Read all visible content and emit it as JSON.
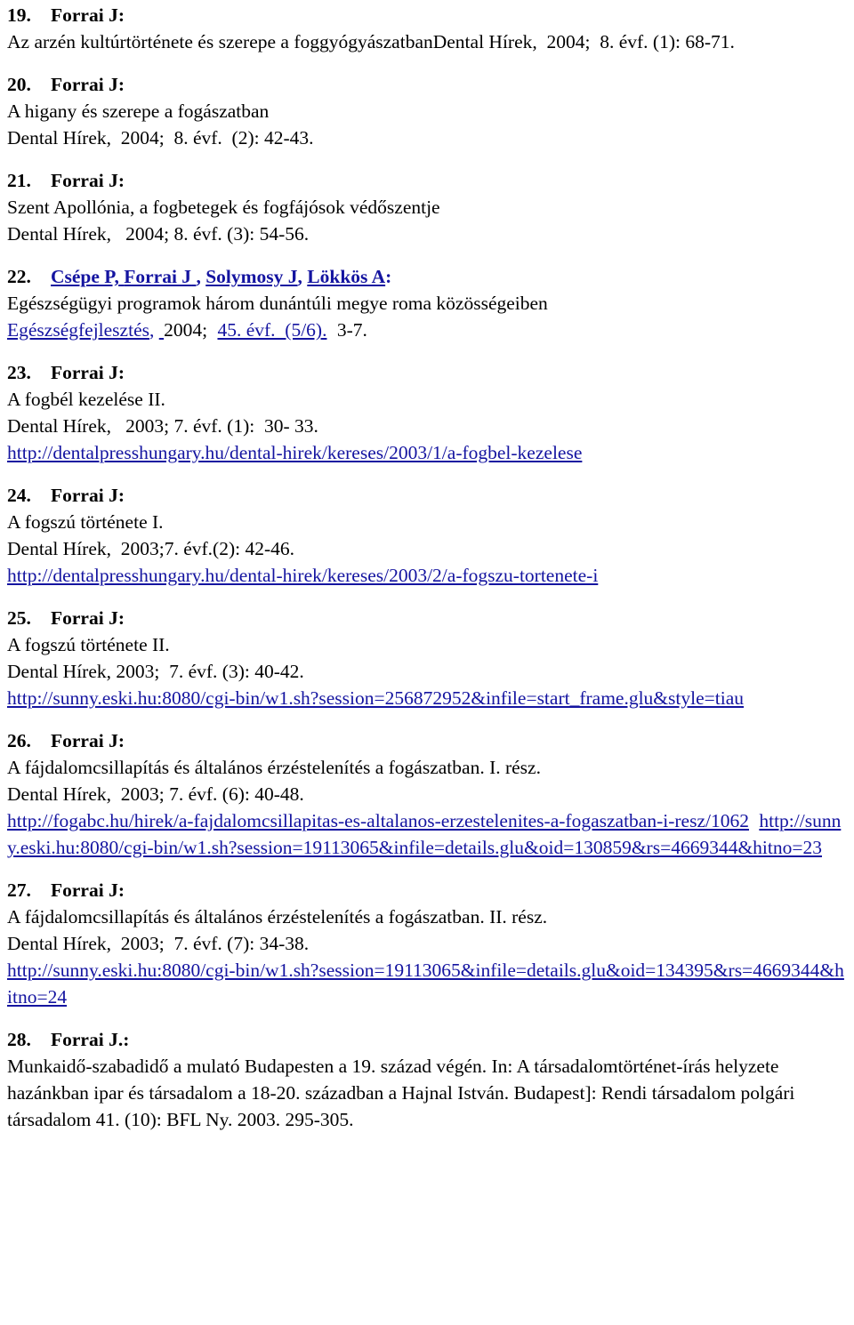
{
  "document": {
    "type": "bibliography-list",
    "language": "hu",
    "link_color": "#1414a0",
    "text_color": "#000000",
    "background": "#ffffff"
  },
  "entries": [
    {
      "number": "19.",
      "author": "Forrai J:",
      "lines": [
        "Az arzén kultúrtörténete és szerepe a foggyógyászatbanDental Hírek,  2004;  8. évf. (1): 68-71."
      ]
    },
    {
      "number": "20.",
      "author": "Forrai J:",
      "lines": [
        "A higany és szerepe a fogászatban",
        "Dental Hírek,  2004;  8. évf.  (2): 42-43."
      ]
    },
    {
      "number": "21.",
      "author": "Forrai J:",
      "lines": [
        "Szent Apollónia, a fogbetegek és fogfájósok védőszentje",
        "Dental Hírek,   2004; 8. évf. (3): 54-56."
      ]
    },
    {
      "number": "22.",
      "authors_linked": {
        "part1": "Csépe P,",
        "part2_bold": "Forrai J",
        "comma1": ",",
        "part3": "Solymosy J",
        "comma2": ",",
        "part4": "Lökkös A",
        "colon": ":"
      },
      "title": "Egészségügyi programok három dunántúli megye roma közösségeiben",
      "source_link1": "Egészségfejlesztés",
      "source_comma": ",",
      "source_year": "2004;",
      "source_link2": "45. évf.  (5/6).",
      "source_pages": "3-7."
    },
    {
      "number": "23.",
      "author": "Forrai J:",
      "lines": [
        "A fogbél kezelése II.",
        "Dental Hírek,   2003; 7. évf. (1):  30- 33."
      ],
      "urls": [
        "http://dentalpresshungary.hu/dental-hirek/kereses/2003/1/a-fogbel-kezelese"
      ]
    },
    {
      "number": "24.",
      "author": "Forrai J:",
      "lines": [
        "A fogszú története I.",
        "Dental Hírek,  2003;7. évf.(2): 42-46."
      ],
      "urls": [
        "http://dentalpresshungary.hu/dental-hirek/kereses/2003/2/a-fogszu-tortenete-i"
      ]
    },
    {
      "number": "25.",
      "author": "Forrai J:",
      "lines": [
        "A fogszú története II.",
        "Dental Hírek, 2003;  7. évf. (3): 40-42."
      ],
      "urls": [
        "http://sunny.eski.hu:8080/cgi-bin/w1.sh?session=256872952&infile=start_frame.glu&style=tiau"
      ]
    },
    {
      "number": "26.",
      "author": "Forrai J:",
      "lines": [
        "A fájdalomcsillapítás és általános érzéstelenítés a fogászatban. I. rész.",
        "Dental Hírek,  2003; 7. évf. (6): 40-48."
      ],
      "urls": [
        "http://fogabc.hu/hirek/a-fajdalomcsillapitas-es-altalanos-erzestelenites-a-fogaszatban-i-resz/1062",
        "http://sunny.eski.hu:8080/cgi-bin/w1.sh?session=19113065&infile=details.glu&oid=130859&rs=4669344&hitno=23"
      ]
    },
    {
      "number": "27.",
      "author": "Forrai J:",
      "lines": [
        "A fájdalomcsillapítás és általános érzéstelenítés a fogászatban. II. rész.",
        "Dental Hírek,  2003;  7. évf. (7): 34-38."
      ],
      "urls": [
        "http://sunny.eski.hu:8080/cgi-bin/w1.sh?session=19113065&infile=details.glu&oid=134395&rs=4669344&hitno=24"
      ]
    },
    {
      "number": "28.",
      "author": "Forrai J.:",
      "lines": [
        "Munkaidő-szabadidő a mulató Budapesten a 19. század végén. In: A társadalomtörténet-írás helyzete hazánkban ipar és társadalom a 18-20. században a Hajnal István. Budapest]: Rendi társadalom polgári társadalom 41. (10): BFL Ny. 2003. 295-305."
      ]
    }
  ]
}
